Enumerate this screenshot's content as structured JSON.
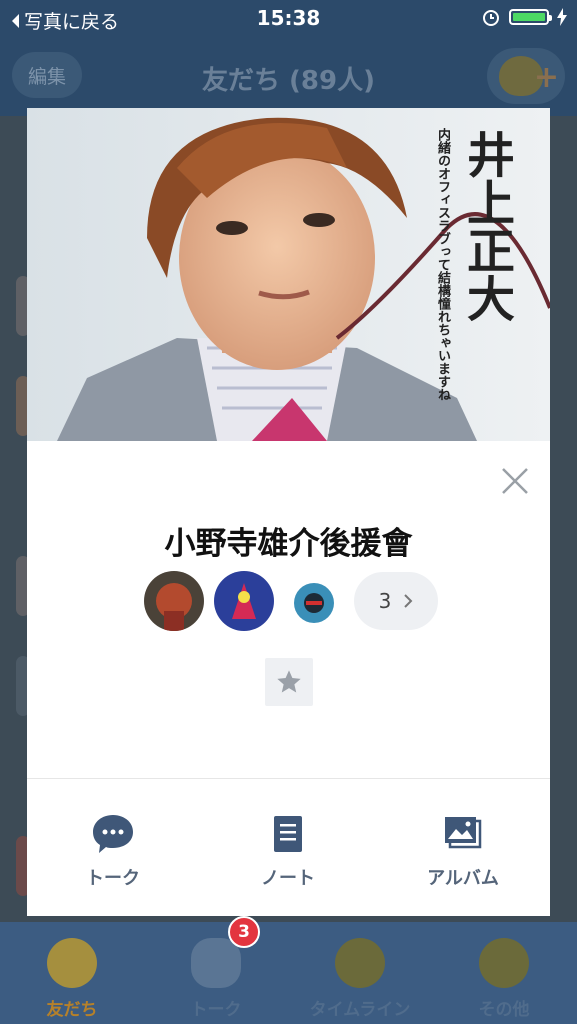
{
  "status": {
    "back_label": "写真に戻る",
    "time": "15:38"
  },
  "header": {
    "edit_label": "編集",
    "title": "友だち (89人)"
  },
  "tabs": [
    {
      "label": "友だち",
      "active": true
    },
    {
      "label": "トーク",
      "badge": "3"
    },
    {
      "label": "タイムライン"
    },
    {
      "label": "その他"
    }
  ],
  "profile": {
    "photo_text": {
      "name": "井上正大",
      "caption": "内緒のオフィスラブって結構憧れちゃいますね"
    },
    "name": "小野寺雄介後援會",
    "members_more_count": "3",
    "actions": [
      {
        "label": "トーク",
        "icon": "chat-icon"
      },
      {
        "label": "ノート",
        "icon": "note-icon"
      },
      {
        "label": "アルバム",
        "icon": "album-icon"
      }
    ]
  },
  "colors": {
    "accent_active": "#b6812a",
    "badge": "#e3353f",
    "battery": "#4cd964"
  }
}
